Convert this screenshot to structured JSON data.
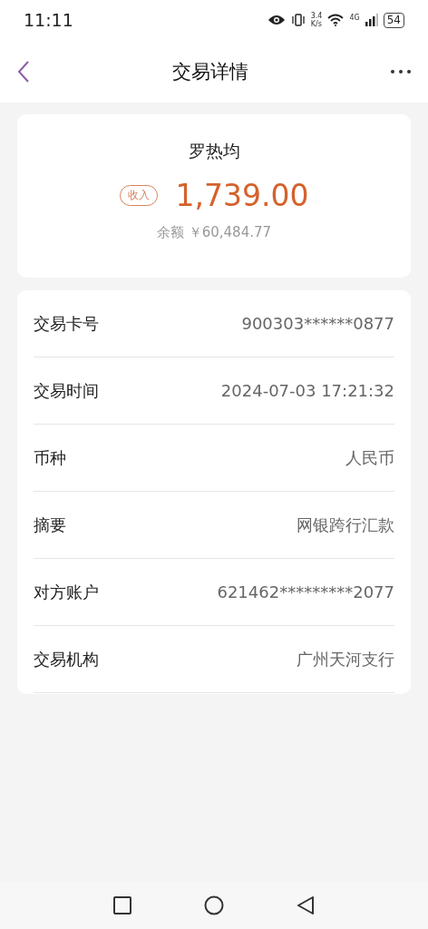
{
  "status_bar": {
    "time": "11:11",
    "speed_value": "3.4",
    "speed_unit": "K/s",
    "network": "4G",
    "battery": "54"
  },
  "header": {
    "title": "交易详情"
  },
  "summary": {
    "name": "罗热均",
    "tag": "收入",
    "amount": "1,739.00",
    "balance_label": "余额",
    "balance": "￥60,484.77"
  },
  "details": [
    {
      "label": "交易卡号",
      "value": "900303******0877"
    },
    {
      "label": "交易时间",
      "value": "2024-07-03 17:21:32"
    },
    {
      "label": "币种",
      "value": "人民币"
    },
    {
      "label": "摘要",
      "value": "网银跨行汇款"
    },
    {
      "label": "对方账户",
      "value": "621462*********2077"
    },
    {
      "label": "交易机构",
      "value": "广州天河支行"
    }
  ]
}
